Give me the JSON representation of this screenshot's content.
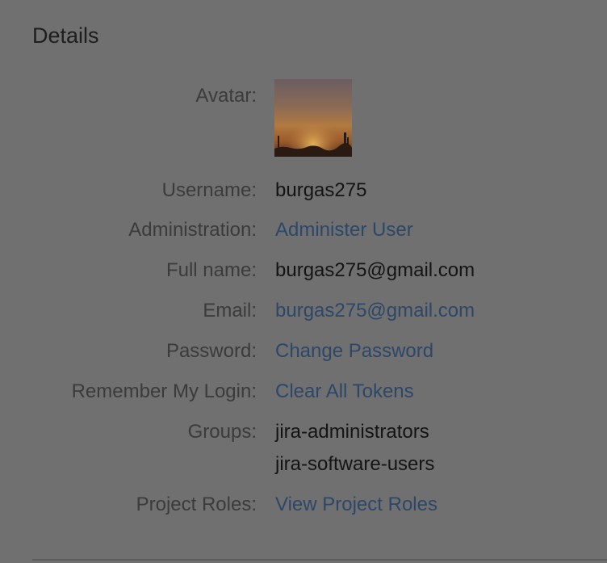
{
  "section": {
    "title": "Details"
  },
  "avatar": {
    "label": "Avatar:",
    "icon": "sunset-avatar-image"
  },
  "fields": {
    "username": {
      "label": "Username:",
      "value": "burgas275"
    },
    "administration": {
      "label": "Administration:",
      "value": "Administer User"
    },
    "full_name": {
      "label": "Full name:",
      "value": "burgas275@gmail.com"
    },
    "email": {
      "label": "Email:",
      "value": "burgas275@gmail.com"
    },
    "password": {
      "label": "Password:",
      "value": "Change Password"
    },
    "remember_login": {
      "label": "Remember My Login:",
      "value": "Clear All Tokens"
    },
    "groups": {
      "label": "Groups:",
      "values": [
        "jira-administrators",
        "jira-software-users"
      ]
    },
    "project_roles": {
      "label": "Project Roles:",
      "value": "View Project Roles"
    }
  },
  "colors": {
    "overlay_background": "#707070",
    "link": "#2c4768",
    "label": "#3b3b3b",
    "value": "#141414"
  }
}
